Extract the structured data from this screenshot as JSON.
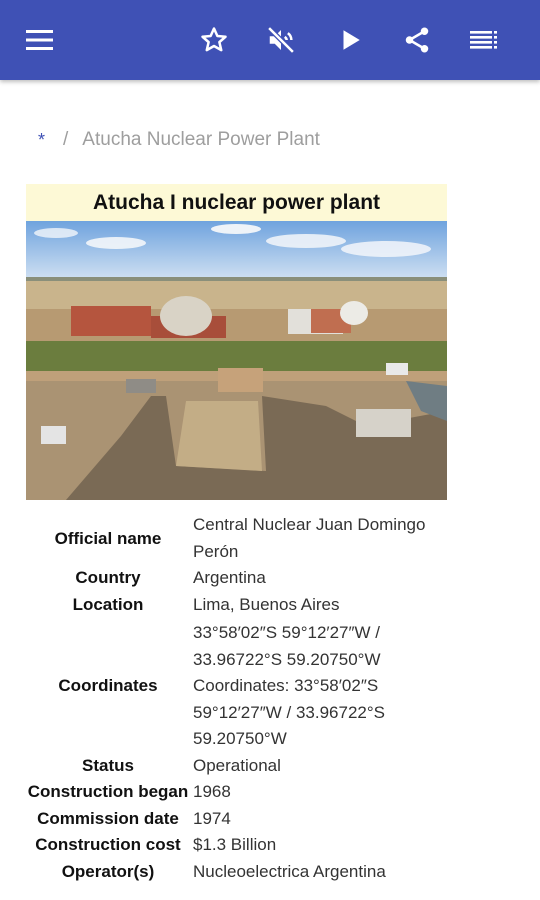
{
  "toolbar": {
    "menu_icon": "menu-icon",
    "star_icon": "star-outline-icon",
    "mute_icon": "volume-off-icon",
    "play_icon": "play-icon",
    "share_icon": "share-icon",
    "toc_icon": "table-of-contents-icon",
    "color": "#3f51b5"
  },
  "breadcrumb": {
    "home": "*",
    "separator": "/",
    "current": "Atucha Nuclear Power Plant"
  },
  "infobox": {
    "title": "Atucha I nuclear power plant",
    "title_bg": "#fdf9d6",
    "rows": [
      {
        "label": "Official name",
        "value": [
          "Central Nuclear Juan Domingo",
          "Perón"
        ]
      },
      {
        "label": "Country",
        "value": [
          "Argentina"
        ]
      },
      {
        "label": "Location",
        "value": [
          "Lima, Buenos Aires"
        ]
      },
      {
        "label": "Coordinates",
        "value": [
          "33°58′02″S 59°12′27″W /",
          "33.96722°S 59.20750°W",
          "Coordinates: 33°58′02″S",
          "59°12′27″W / 33.96722°S",
          "59.20750°W"
        ]
      },
      {
        "label": "Status",
        "value": [
          "Operational"
        ]
      },
      {
        "label": "Construction began",
        "value": [
          "1968"
        ]
      },
      {
        "label": "Commission date",
        "value": [
          "1974"
        ]
      },
      {
        "label": "Construction cost",
        "value": [
          "$1.3 Billion"
        ]
      },
      {
        "label": "Operator(s)",
        "value": [
          "Nucleoelectrica Argentina"
        ]
      }
    ]
  }
}
